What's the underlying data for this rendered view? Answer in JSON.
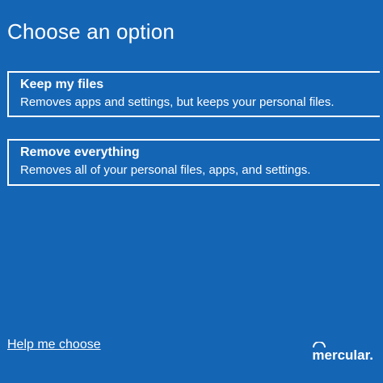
{
  "screen": {
    "title": "Choose an option"
  },
  "options": [
    {
      "title": "Keep my files",
      "description": "Removes apps and settings, but keeps your personal files."
    },
    {
      "title": "Remove everything",
      "description": "Removes all of your personal files, apps, and settings."
    }
  ],
  "help_link": "Help me choose",
  "watermark": {
    "text": "mercular."
  },
  "colors": {
    "background": "#1565b5",
    "text": "#ffffff"
  }
}
